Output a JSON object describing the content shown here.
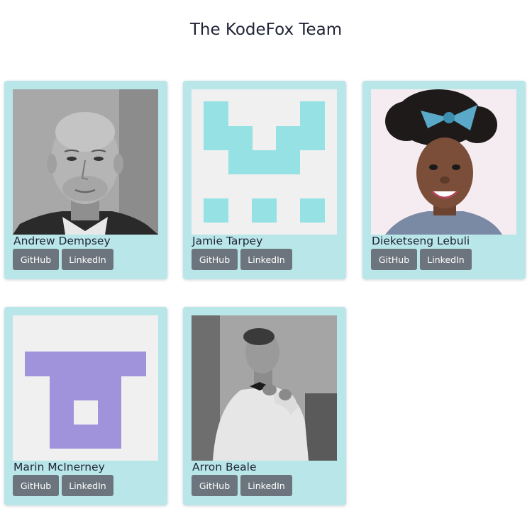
{
  "page": {
    "title": "The KodeFox Team"
  },
  "members": [
    {
      "name": "Andrew Dempsey",
      "photo": "photo-bald-man-grayscale",
      "github_label": "GitHub",
      "linkedin_label": "LinkedIn"
    },
    {
      "name": "Jamie Tarpey",
      "photo": "identicon-teal",
      "identicon_color": "#95e1e3",
      "github_label": "GitHub",
      "linkedin_label": "LinkedIn"
    },
    {
      "name": "Dieketseng Lebuli",
      "photo": "photo-woman-blue-bow",
      "github_label": "GitHub",
      "linkedin_label": "LinkedIn"
    },
    {
      "name": "Marin McInerney",
      "photo": "identicon-purple",
      "identicon_color": "#a093dc",
      "github_label": "GitHub",
      "linkedin_label": "LinkedIn"
    },
    {
      "name": "Arron Beale",
      "photo": "photo-man-bowtie-grayscale",
      "github_label": "GitHub",
      "linkedin_label": "LinkedIn"
    }
  ],
  "colors": {
    "card_background": "#b9e6e8",
    "button_background": "#6c757d",
    "button_text": "#ffffff",
    "text": "#1f2335",
    "identicon_background": "#f0f0f0"
  }
}
